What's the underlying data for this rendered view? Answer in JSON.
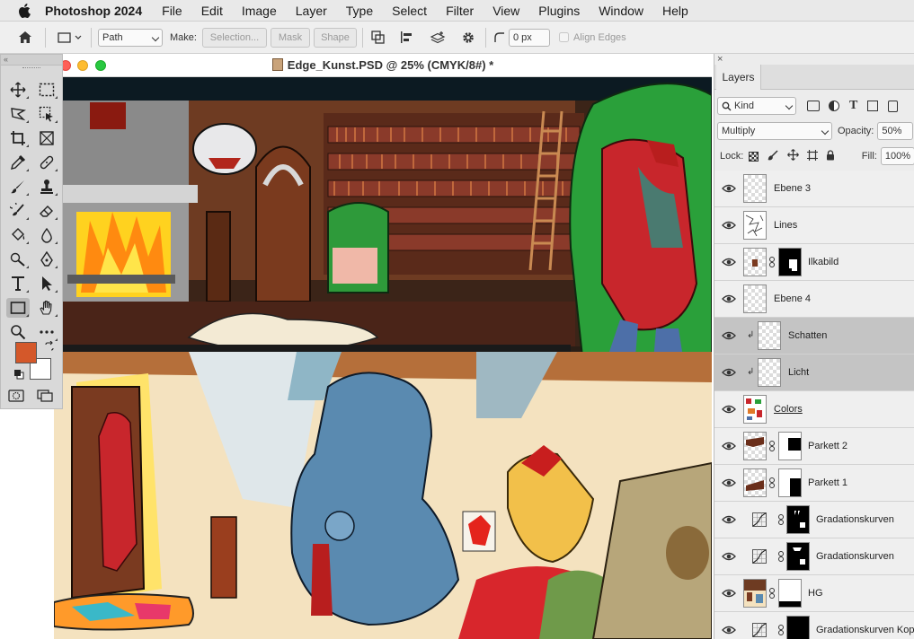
{
  "menubar": {
    "app_name": "Photoshop 2024",
    "items": [
      "File",
      "Edit",
      "Image",
      "Layer",
      "Type",
      "Select",
      "Filter",
      "View",
      "Plugins",
      "Window",
      "Help"
    ]
  },
  "options": {
    "mode_value": "Path",
    "make_label": "Make:",
    "selection_label": "Selection...",
    "mask_label": "Mask",
    "shape_label": "Shape",
    "radius_value": "0 px",
    "align_edges_label": "Align Edges"
  },
  "document": {
    "title": "Edge_Kunst.PSD @ 25% (CMYK/8#) *"
  },
  "layers_panel": {
    "tab_label": "Layers",
    "filter_kind": "Kind",
    "blend_mode": "Multiply",
    "opacity_label": "Opacity:",
    "opacity_value": "50%",
    "lock_label": "Lock:",
    "fill_label": "Fill:",
    "fill_value": "100%",
    "layers": [
      {
        "name": "Ebene 3",
        "type": "pixel"
      },
      {
        "name": "Lines",
        "type": "pixel"
      },
      {
        "name": "Ilkabild",
        "type": "pixel-mask"
      },
      {
        "name": "Ebene 4",
        "type": "pixel"
      },
      {
        "name": "Schatten",
        "type": "clipped",
        "selected": true
      },
      {
        "name": "Licht",
        "type": "clipped",
        "selected": true
      },
      {
        "name": "Colors",
        "type": "pixel"
      },
      {
        "name": "Parkett 2",
        "type": "pixel-mask"
      },
      {
        "name": "Parkett 1",
        "type": "pixel-mask"
      },
      {
        "name": "Gradationskurven",
        "type": "adjustment"
      },
      {
        "name": "Gradationskurven",
        "type": "adjustment"
      },
      {
        "name": "HG",
        "type": "pixel-mask"
      },
      {
        "name": "Gradationskurven Kopie",
        "type": "adjustment"
      }
    ]
  },
  "colors": {
    "foreground": "#d4582a",
    "background": "#ffffff",
    "selection_row": "#c4c4c4"
  }
}
